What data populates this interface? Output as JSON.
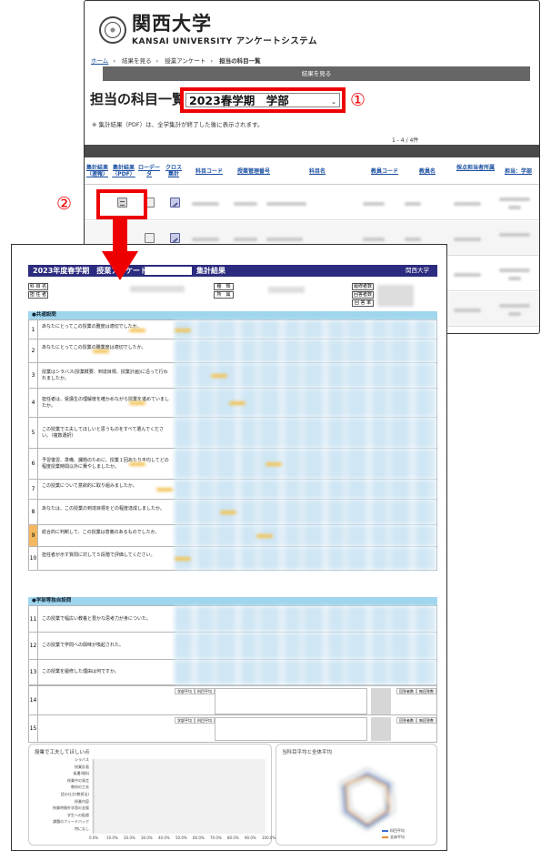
{
  "portal": {
    "brand_jp": "関西大学",
    "brand_en": "KANSAI UNIVERSITY",
    "system_name": "アンケートシステム",
    "breadcrumb": [
      "ホーム",
      "結果を見る",
      "授業アンケート",
      "担当の科目一覧"
    ],
    "tab_label": "結果を見る",
    "heading": "担当の科目一覧",
    "term_selected": "2023春学期　学部",
    "note": "※ 集計結果（PDF）は、全学集計が終了した後に表示されます。",
    "count": "1 - 4 / 4件",
    "table_headers": [
      "集計結果\n（速報）",
      "集計結果\n（PDF）",
      "ローデー\nタ",
      "クロス\n集計",
      "科目コード",
      "授業管理番号",
      "科目名",
      "教員コード",
      "教員名",
      "採点担当者所属",
      "担当：学部"
    ],
    "marker_1": "①",
    "marker_2": "②"
  },
  "report": {
    "title_left": "2023年度春学期　授業アンケート",
    "title_mid": "集計結果",
    "title_right": "関西大学",
    "info_labels": {
      "subject": "科 目 名",
      "teacher": "担 任 者",
      "category": "種　類",
      "affiliation": "所　属",
      "enrolled": "履修者数",
      "respondents": "回答者数",
      "rate": "回 答 率"
    },
    "section_common": "●共通設問",
    "section_faculty": "●学部等独自設問",
    "questions": [
      {
        "no": "1",
        "text": "あなたにとってこの授業の難度は適切でしたか。"
      },
      {
        "no": "2",
        "text": "あなたにとってこの授業の職業度は適切でしたか。"
      },
      {
        "no": "3",
        "text": "授業はシラバス(授業概要、到達目標、授業計画)に沿って行われましたか。"
      },
      {
        "no": "4",
        "text": "担任者は、受講生の理解度を確かめながら授業を進めていましたか。"
      },
      {
        "no": "5",
        "text": "この授業で工夫してほしいと思うものをすべて選んでください。（複数選択）"
      },
      {
        "no": "6",
        "text": "予習復習、準備、課題のために、授業１回あたり平均してどの程度授業時間以外に費やしましたか。"
      },
      {
        "no": "7",
        "text": "この授業について意欲的に取り組みましたか。"
      },
      {
        "no": "8",
        "text": "あなたは、この授業の到達目標をどの程度達成しましたか。"
      },
      {
        "no": "9",
        "text": "総合的に判断して、この授業は意義のあるものでしたか。"
      },
      {
        "no": "10",
        "text": "担任者が示す質問に対して５段階で評価してください。"
      }
    ],
    "faculty_questions": [
      {
        "no": "11",
        "text": "この授業で幅広い教養と豊かな思考力が身についた。"
      },
      {
        "no": "12",
        "text": "この授業で学問への興味が喚起された。"
      },
      {
        "no": "13",
        "text": "この授業を履修した理由は何ですか。"
      }
    ],
    "free_rows": [
      "14",
      "15"
    ],
    "q14_cells": [
      "学部平均",
      "科目平均",
      "回答者数",
      "無回答数"
    ],
    "left_panel_title": "授業で工夫してほしい点",
    "left_panel_labels": [
      "シラバス",
      "授業計画",
      "板書/資料",
      "授業中の発言",
      "教材の工夫",
      "話の仕方(教授法)",
      "授業内容",
      "授業時間外学習の支援",
      "学生への配慮",
      "課題のフィードバック",
      "特になし"
    ],
    "left_panel_axis": [
      "0.0%",
      "10.0%",
      "20.0%",
      "30.0%",
      "40.0%",
      "50.0%",
      "60.0%",
      "70.0%",
      "80.0%",
      "90.0%",
      "100.0%"
    ],
    "right_panel_title": "当科目平均と全体平均",
    "legend": [
      "科目平均",
      "全体平均"
    ]
  },
  "colors": {
    "accent_red": "#ee0000",
    "report_header": "#2b2b7f",
    "section_bar": "#9fd6ee"
  }
}
